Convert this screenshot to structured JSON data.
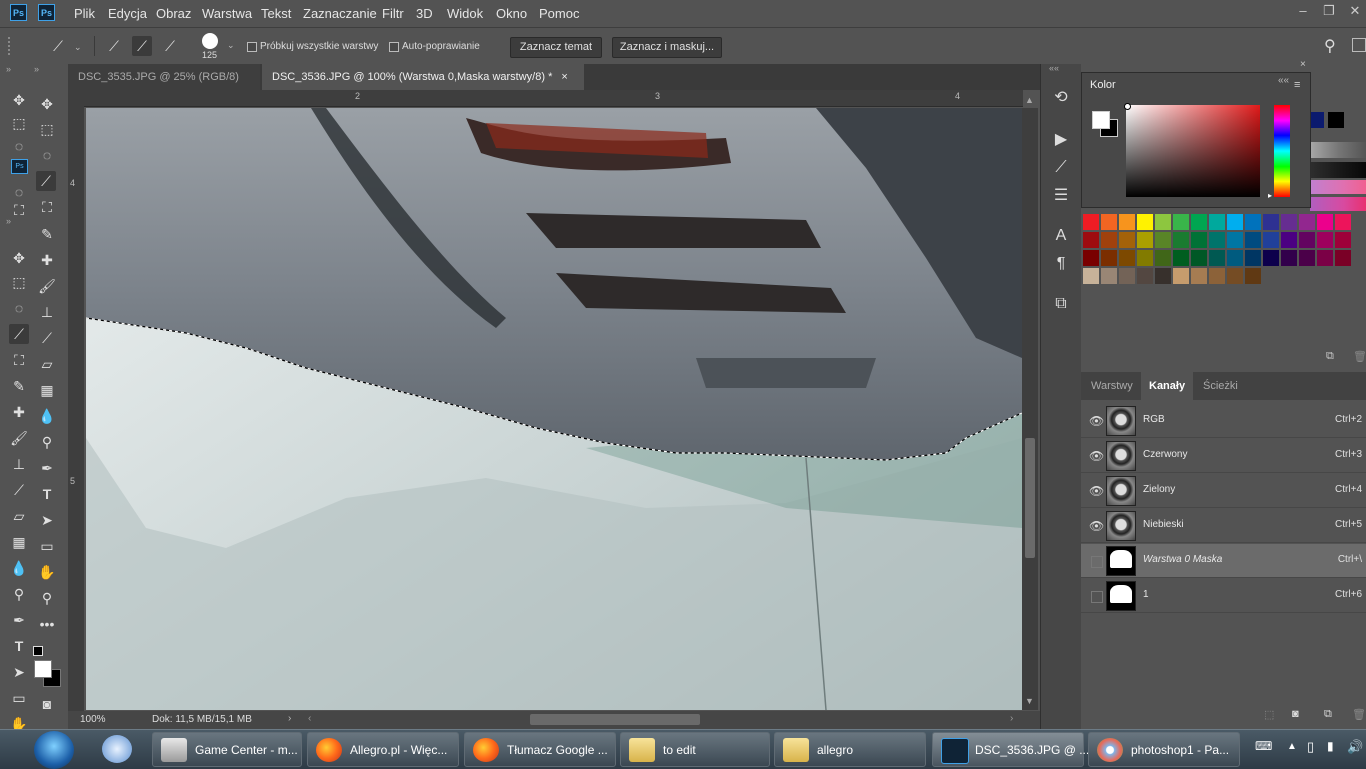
{
  "menubar": {
    "logos": [
      "Ps",
      "Ps"
    ],
    "items": [
      "Plik",
      "Edycja",
      "Obraz",
      "Warstwa",
      "Tekst",
      "Zaznaczanie",
      "Filtr",
      "3D",
      "Widok",
      "Okno",
      "Pomoc"
    ],
    "window_buttons": [
      "–",
      "❐",
      "✕"
    ]
  },
  "options": {
    "brush_size": "125",
    "sample_all_layers": "Próbkuj wszystkie warstwy",
    "auto_enhance": "Auto-poprawianie",
    "select_subject": "Zaznacz temat",
    "select_and_mask": "Zaznacz i maskuj..."
  },
  "tabs": [
    {
      "label": "DSC_3535.JPG @ 25% (RGB/8)",
      "close": "×",
      "active": false
    },
    {
      "label": "DSC_3536.JPG @ 100% (Warstwa 0,Maska warstwy/8) *",
      "close": "×",
      "active": true
    }
  ],
  "rulers": {
    "top": [
      "2",
      "3",
      "4"
    ],
    "left": [
      "4",
      "5"
    ]
  },
  "status": {
    "zoom": "100%",
    "doc": "Dok: 11,5 MB/15,1 MB"
  },
  "color_panel": {
    "title": "Kolor",
    "foreground": "#ffffff",
    "background": "#000000"
  },
  "channels_panel": {
    "tabs": [
      "Warstwy",
      "Kanały",
      "Ścieżki"
    ],
    "active_tab": "Kanały",
    "rows": [
      {
        "name": "RGB",
        "shortcut": "Ctrl+2",
        "visible": true,
        "thumb": "photo"
      },
      {
        "name": "Czerwony",
        "shortcut": "Ctrl+3",
        "visible": true,
        "thumb": "photo"
      },
      {
        "name": "Zielony",
        "shortcut": "Ctrl+4",
        "visible": true,
        "thumb": "photo"
      },
      {
        "name": "Niebieski",
        "shortcut": "Ctrl+5",
        "visible": true,
        "thumb": "photo"
      },
      {
        "name": "Warstwa 0 Maska",
        "shortcut": "Ctrl+\\",
        "visible": false,
        "thumb": "mask",
        "selected": true
      },
      {
        "name": "1",
        "shortcut": "Ctrl+6",
        "visible": false,
        "thumb": "mask"
      }
    ]
  },
  "taskbar": {
    "items": [
      {
        "label": "Game Center - m...",
        "icon": "game-center-icon"
      },
      {
        "label": "Allegro.pl - Więc...",
        "icon": "firefox-icon"
      },
      {
        "label": "Tłumacz Google ...",
        "icon": "firefox-icon"
      },
      {
        "label": "to edit",
        "icon": "folder-icon"
      },
      {
        "label": "allegro",
        "icon": "folder-icon"
      },
      {
        "label": "DSC_3536.JPG @ ...",
        "icon": "photoshop-icon"
      },
      {
        "label": "photoshop1 - Pa...",
        "icon": "paint-icon"
      }
    ]
  }
}
